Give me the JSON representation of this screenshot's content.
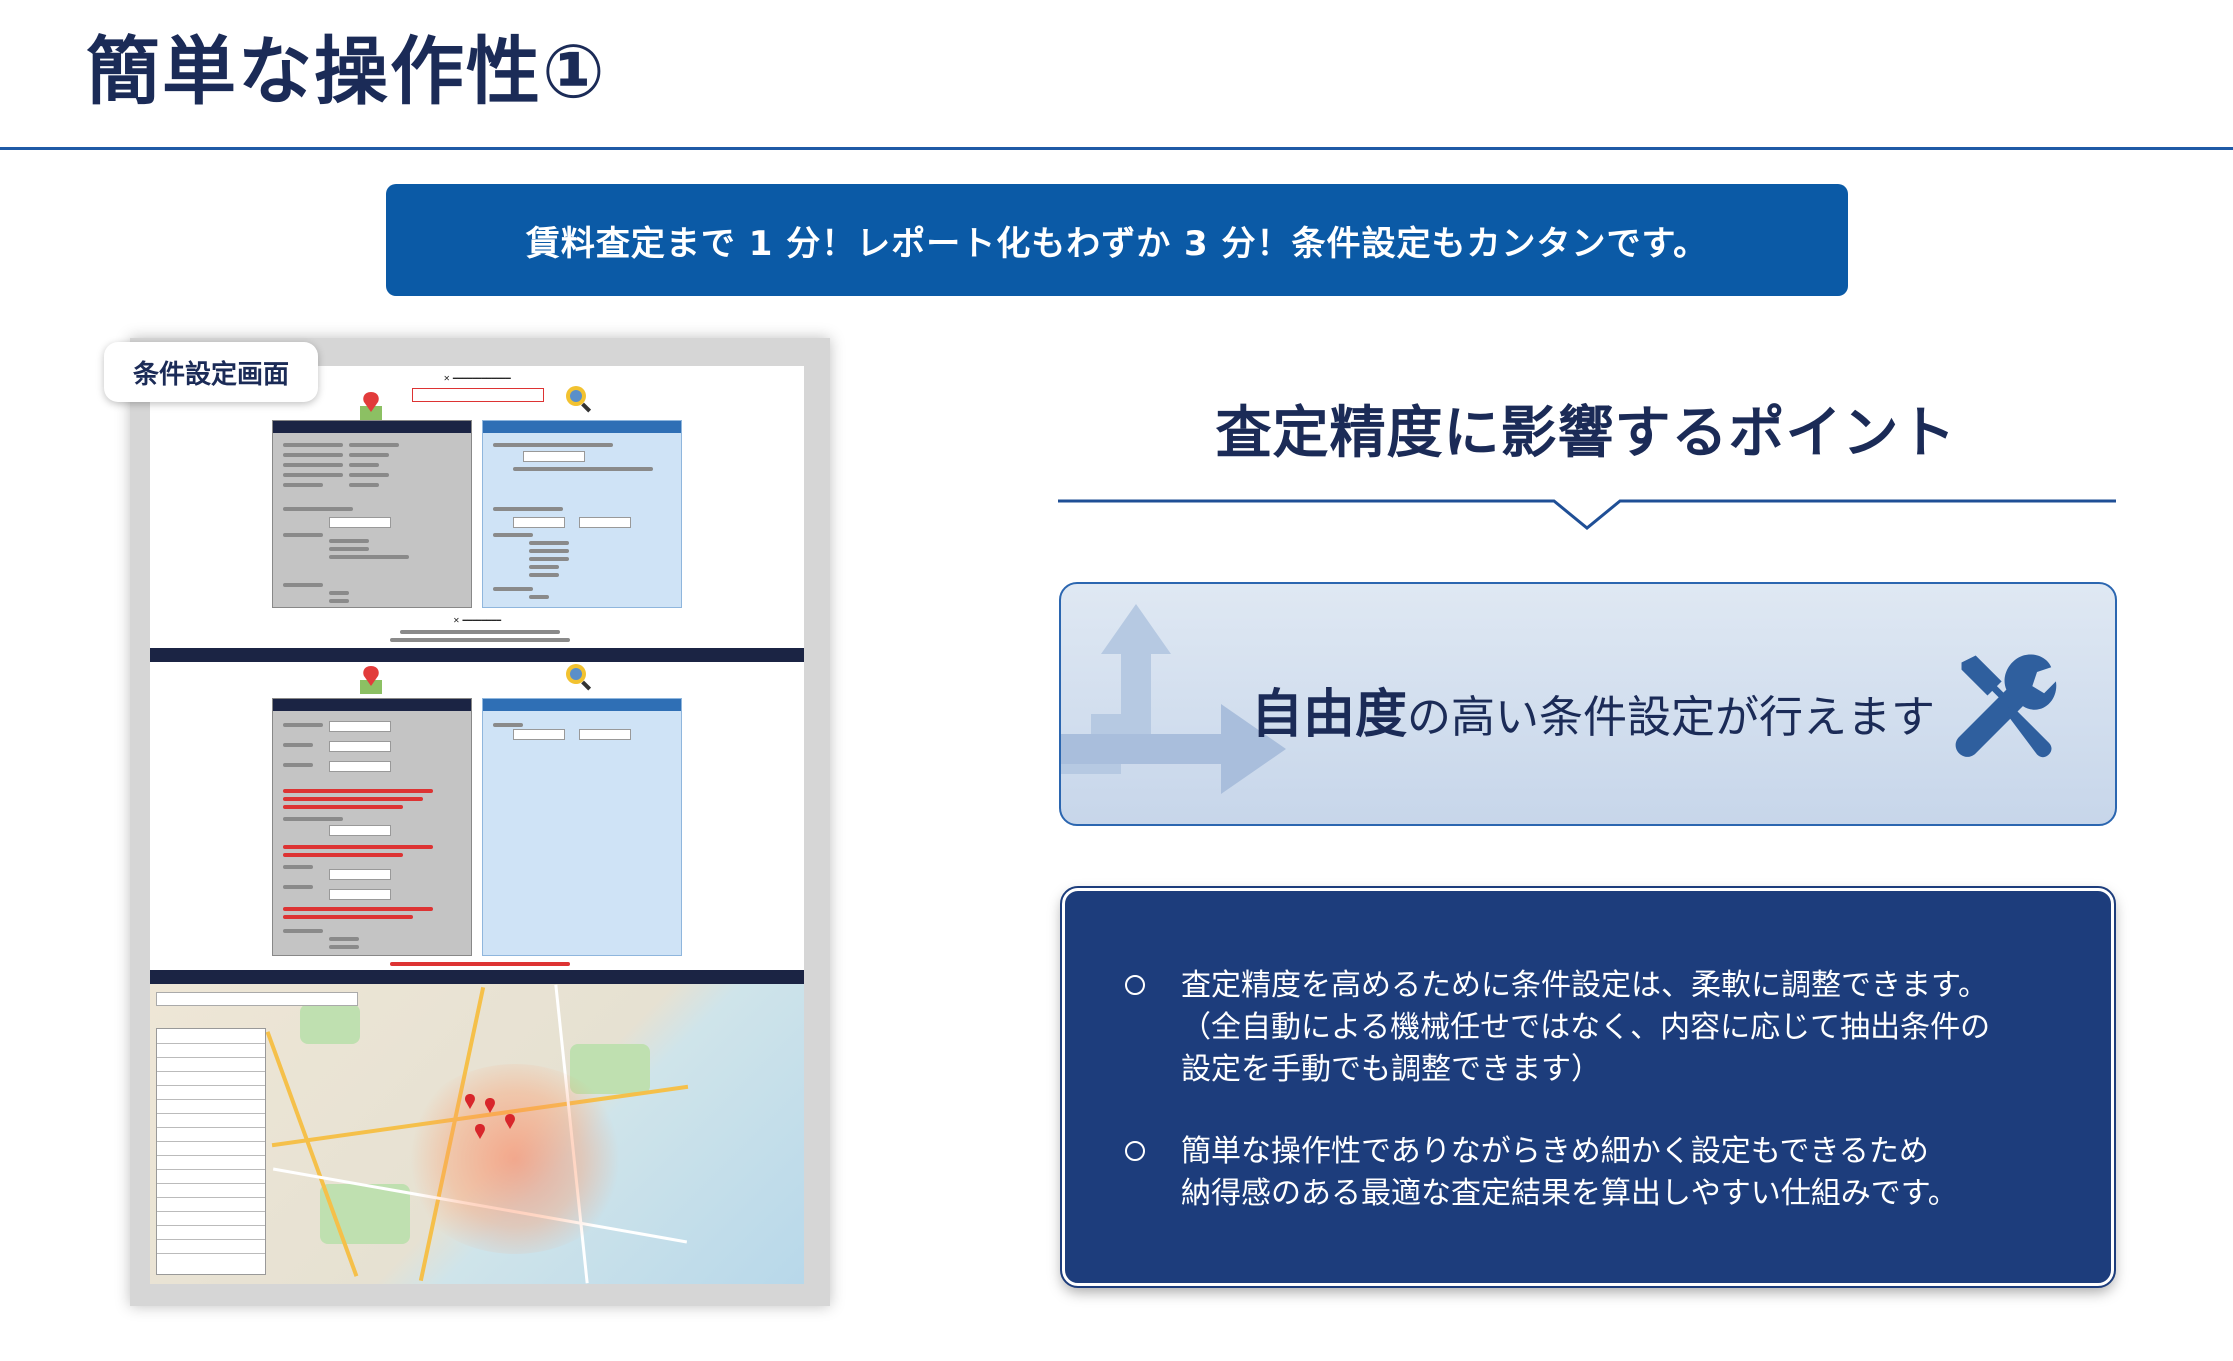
{
  "header": {
    "title": "簡単な操作性①"
  },
  "banner": {
    "text": "賃料査定まで 1 分！レポート化もわずか 3 分！条件設定もカンタンです。"
  },
  "screenshot": {
    "tag": "条件設定画面"
  },
  "point": {
    "title": "査定精度に影響するポイント",
    "free_strong": "自由度",
    "free_rest": "の高い条件設定が行えます"
  },
  "bullets": [
    {
      "lines": [
        "査定精度を高めるために条件設定は、柔軟に調整できます。",
        "（全自動による機械任せではなく、内容に応じて抽出条件の",
        "設定を手動でも調整できます）"
      ]
    },
    {
      "lines": [
        "簡単な操作性でありながらきめ細かく設定もできるため",
        "納得感のある最適な査定結果を算出しやすい仕組みです。"
      ]
    }
  ],
  "colors": {
    "navy": "#1b2b57",
    "banner": "#0b5aa6",
    "box_dark": "#1d3d7c",
    "accent": "#2b66b0"
  },
  "icons": [
    "tools-icon",
    "arrow-up-icon",
    "arrow-right-icon",
    "map-pin-icon",
    "magnifier-icon"
  ]
}
